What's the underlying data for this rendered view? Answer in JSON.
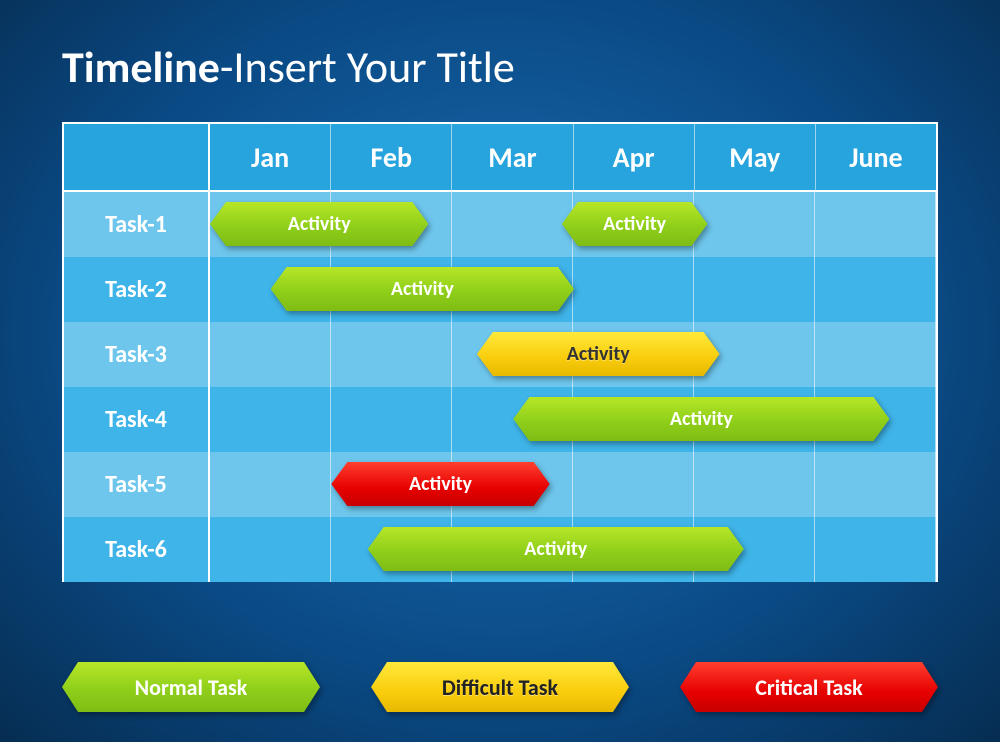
{
  "title": {
    "bold": "Timeline",
    "rest": "-Insert Your Title"
  },
  "months": [
    "Jan",
    "Feb",
    "Mar",
    "Apr",
    "May",
    "June"
  ],
  "tasks": [
    "Task-1",
    "Task-2",
    "Task-3",
    "Task-4",
    "Task-5",
    "Task-6"
  ],
  "bars": [
    {
      "row": 0,
      "label": "Activity",
      "type": "green",
      "start": 0.0,
      "span": 1.8
    },
    {
      "row": 0,
      "label": "Activity",
      "type": "green",
      "start": 2.9,
      "span": 1.2
    },
    {
      "row": 1,
      "label": "Activity",
      "type": "green",
      "start": 0.5,
      "span": 2.5
    },
    {
      "row": 2,
      "label": "Activity",
      "type": "yellow",
      "start": 2.2,
      "span": 2.0
    },
    {
      "row": 3,
      "label": "Activity",
      "type": "green",
      "start": 2.5,
      "span": 3.1
    },
    {
      "row": 4,
      "label": "Activity",
      "type": "red",
      "start": 1.0,
      "span": 1.8
    },
    {
      "row": 5,
      "label": "Activity",
      "type": "green",
      "start": 1.3,
      "span": 3.1
    }
  ],
  "legend": [
    {
      "label": "Normal Task",
      "type": "green"
    },
    {
      "label": "Difficult Task",
      "type": "yellow"
    },
    {
      "label": "Critical Task",
      "type": "red"
    }
  ],
  "colors": {
    "green": "#8fcf1a",
    "yellow": "#f9cc0c",
    "red": "#e60000"
  },
  "chart_data": {
    "type": "bar",
    "title": "Timeline-Insert Your Title",
    "xlabel": "",
    "ylabel": "",
    "categories": [
      "Jan",
      "Feb",
      "Mar",
      "Apr",
      "May",
      "June"
    ],
    "x_range": [
      0,
      6
    ],
    "series": [
      {
        "name": "Task-1",
        "segments": [
          {
            "start": 0.0,
            "end": 1.8,
            "label": "Activity",
            "category": "Normal Task"
          },
          {
            "start": 2.9,
            "end": 4.1,
            "label": "Activity",
            "category": "Normal Task"
          }
        ]
      },
      {
        "name": "Task-2",
        "segments": [
          {
            "start": 0.5,
            "end": 3.0,
            "label": "Activity",
            "category": "Normal Task"
          }
        ]
      },
      {
        "name": "Task-3",
        "segments": [
          {
            "start": 2.2,
            "end": 4.2,
            "label": "Activity",
            "category": "Difficult Task"
          }
        ]
      },
      {
        "name": "Task-4",
        "segments": [
          {
            "start": 2.5,
            "end": 5.6,
            "label": "Activity",
            "category": "Normal Task"
          }
        ]
      },
      {
        "name": "Task-5",
        "segments": [
          {
            "start": 1.0,
            "end": 2.8,
            "label": "Activity",
            "category": "Critical Task"
          }
        ]
      },
      {
        "name": "Task-6",
        "segments": [
          {
            "start": 1.3,
            "end": 4.4,
            "label": "Activity",
            "category": "Normal Task"
          }
        ]
      }
    ],
    "legend": [
      "Normal Task",
      "Difficult Task",
      "Critical Task"
    ]
  }
}
